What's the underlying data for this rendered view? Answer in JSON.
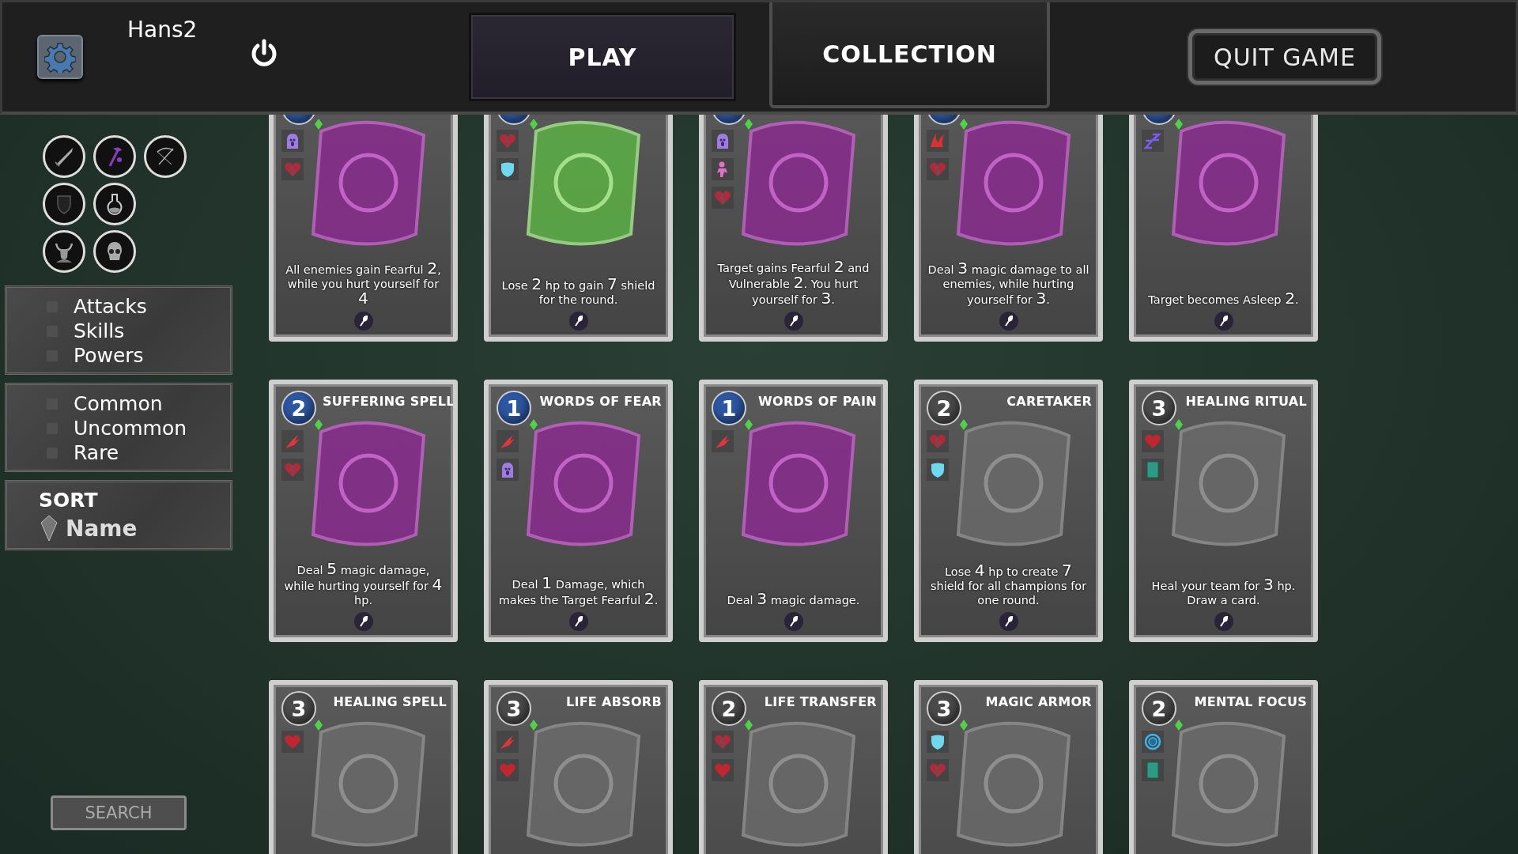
{
  "header": {
    "player_name": "Hans2",
    "tabs": [
      {
        "label": "PLAY",
        "selected": false
      },
      {
        "label": "COLLECTION",
        "selected": true
      }
    ],
    "quit_button": "QUIT GAME"
  },
  "sidebar": {
    "class_filters": [
      {
        "kind": "sword"
      },
      {
        "kind": "staff"
      },
      {
        "kind": "bow"
      },
      {
        "kind": "shield"
      },
      {
        "kind": "potion"
      },
      {
        "kind": "horned"
      },
      {
        "kind": "skull"
      }
    ],
    "type_filters": [
      {
        "label": "Attacks",
        "checked": false
      },
      {
        "label": "Skills",
        "checked": false
      },
      {
        "label": "Powers",
        "checked": false
      }
    ],
    "rarity_filters": [
      {
        "label": "Common",
        "checked": false
      },
      {
        "label": "Uncommon",
        "checked": false
      },
      {
        "label": "Rare",
        "checked": false
      }
    ],
    "sort": {
      "title": "SORT",
      "value": "Name"
    },
    "search_button": "SEARCH"
  },
  "cards": [
    {
      "color": "#2d56a0",
      "kind": "magic",
      "effects": [
        {
          "kind": "fear"
        },
        {
          "kind": "broken-heart"
        }
      ],
      "description": "All enemies gain Fearful **2**, while you hurt yourself for **4**"
    },
    {
      "color": "#2d56a0",
      "kind": "guard",
      "effects": [
        {
          "kind": "broken-heart"
        },
        {
          "kind": "shield"
        }
      ],
      "description": "Lose **2** hp to gain **7** shield for the round."
    },
    {
      "color": "#2d56a0",
      "kind": "magic",
      "effects": [
        {
          "kind": "fear"
        },
        {
          "kind": "stun"
        },
        {
          "kind": "broken-heart"
        }
      ],
      "description": "Target gains Fearful **2** and Vulnerable **2**. You hurt yourself for **3**."
    },
    {
      "color": "#2d56a0",
      "kind": "magic",
      "effects": [
        {
          "kind": "burn"
        },
        {
          "kind": "broken-heart"
        }
      ],
      "description": "Deal **3** magic damage to all enemies, while hurting yourself for **3**."
    },
    {
      "color": "#2d56a0",
      "kind": "magic",
      "effects": [
        {
          "kind": "sleep"
        }
      ],
      "description": "Target becomes Asleep **2**."
    },
    {
      "cost": "2",
      "color": "#2d56a0",
      "title": "SUFFERING SPELL",
      "kind": "magic",
      "effects": [
        {
          "kind": "claw"
        },
        {
          "kind": "broken-heart"
        }
      ],
      "description": "Deal **5** magic damage, while hurting yourself for **4** hp."
    },
    {
      "cost": "1",
      "color": "#2d56a0",
      "title": "WORDS OF FEAR",
      "kind": "magic",
      "effects": [
        {
          "kind": "claw"
        },
        {
          "kind": "fear"
        }
      ],
      "description": "Deal **1** Damage, which makes the Target Fearful **2**."
    },
    {
      "cost": "1",
      "color": "#2d56a0",
      "title": "WORDS OF PAIN",
      "kind": "magic",
      "effects": [
        {
          "kind": "claw"
        }
      ],
      "description": "Deal **3** magic damage."
    },
    {
      "cost": "2",
      "color": "#4a4a4a",
      "title": "CARETAKER",
      "kind": "locked",
      "effects": [
        {
          "kind": "broken-heart"
        },
        {
          "kind": "shield"
        }
      ],
      "description": "Lose **4** hp to create **7** shield for all champions for one round."
    },
    {
      "cost": "3",
      "color": "#4a4a4a",
      "title": "HEALING RITUAL",
      "kind": "locked",
      "effects": [
        {
          "kind": "heart"
        },
        {
          "kind": "card"
        }
      ],
      "description": "Heal your team for **3** hp. Draw a card."
    },
    {
      "cost": "3",
      "color": "#4a4a4a",
      "title": "HEALING SPELL",
      "kind": "locked",
      "effects": [
        {
          "kind": "heart"
        }
      ]
    },
    {
      "cost": "3",
      "color": "#4a4a4a",
      "title": "LIFE ABSORB",
      "kind": "locked",
      "effects": [
        {
          "kind": "claw"
        },
        {
          "kind": "heart"
        }
      ]
    },
    {
      "cost": "2",
      "color": "#4a4a4a",
      "title": "LIFE TRANSFER",
      "kind": "locked",
      "effects": [
        {
          "kind": "broken-heart"
        },
        {
          "kind": "heart"
        }
      ]
    },
    {
      "cost": "3",
      "color": "#4a4a4a",
      "title": "MAGIC ARMOR",
      "kind": "locked",
      "effects": [
        {
          "kind": "shield"
        },
        {
          "kind": "broken-heart"
        }
      ]
    },
    {
      "cost": "2",
      "color": "#4a4a4a",
      "title": "MENTAL FOCUS",
      "kind": "locked",
      "effects": [
        {
          "kind": "focus"
        },
        {
          "kind": "card"
        }
      ]
    }
  ]
}
